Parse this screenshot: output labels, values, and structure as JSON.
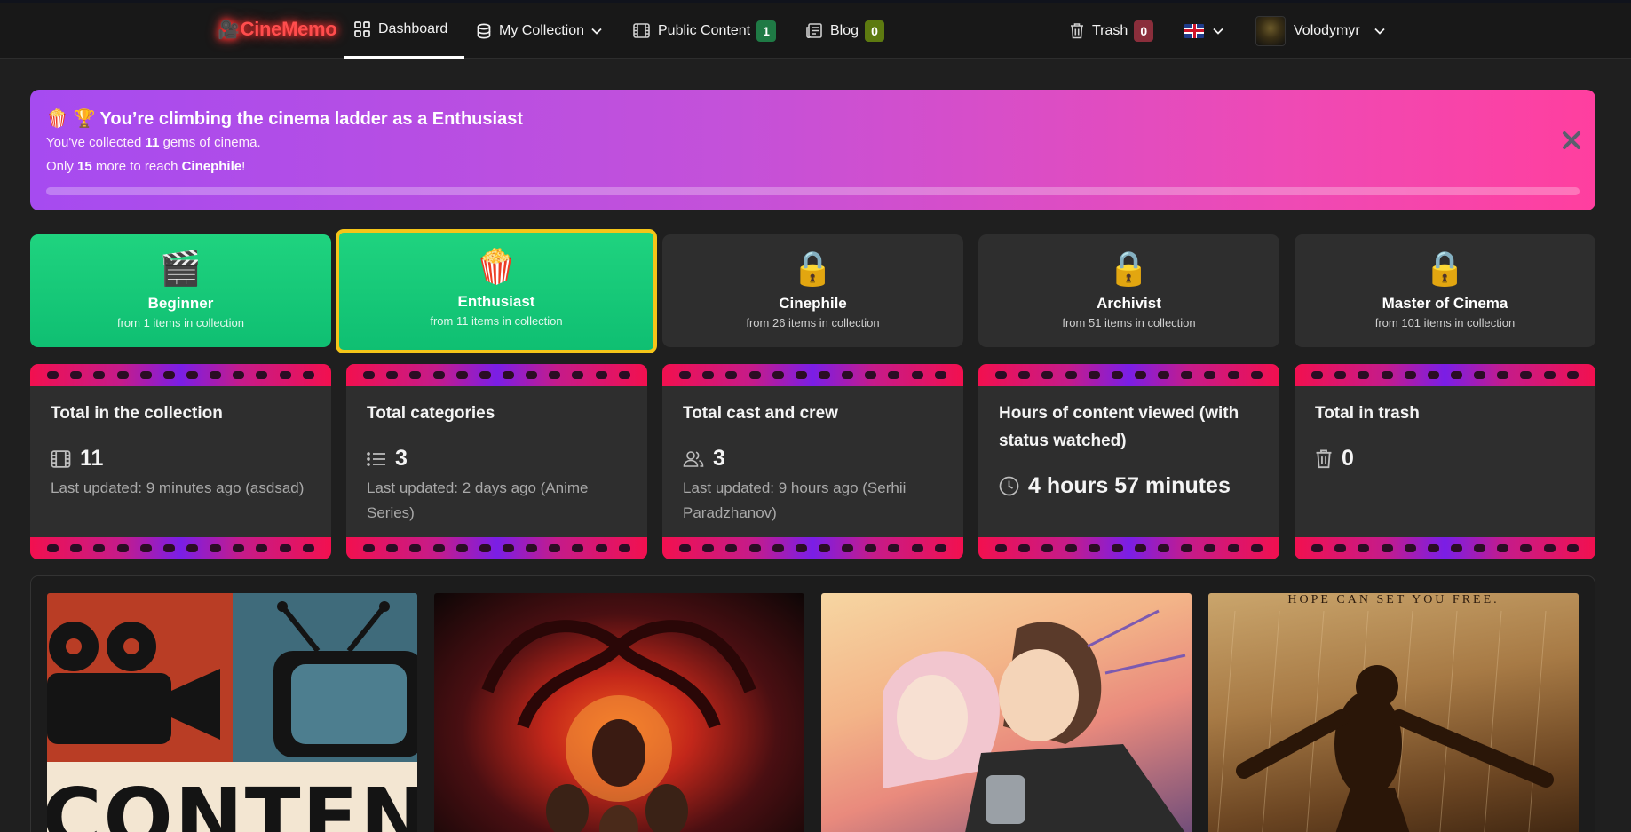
{
  "nav": {
    "brand": "CineMemo",
    "dashboard": "Dashboard",
    "collection": "My Collection",
    "public_content": "Public Content",
    "public_count": "1",
    "blog": "Blog",
    "blog_count": "0",
    "trash": "Trash",
    "trash_count": "0",
    "user": "Volodymyr"
  },
  "banner": {
    "title": "🍿 🏆 You’re climbing the cinema ladder as a Enthusiast",
    "line1_pre": "You've collected ",
    "line1_num": "11",
    "line1_post": " gems of cinema.",
    "line2_pre": "Only ",
    "line2_num": "15",
    "line2_mid": " more to reach ",
    "line2_level": "Cinephile",
    "line2_post": "!",
    "progress": 0
  },
  "levels": [
    {
      "emoji": "🎬",
      "name": "Beginner",
      "req": "from 1 items in collection"
    },
    {
      "emoji": "🍿",
      "name": "Enthusiast",
      "req": "from 11 items in collection"
    },
    {
      "emoji": "🔒",
      "name": "Cinephile",
      "req": "from 26 items in collection"
    },
    {
      "emoji": "🔒",
      "name": "Archivist",
      "req": "from 51 items in collection"
    },
    {
      "emoji": "🔒",
      "name": "Master of Cinema",
      "req": "from 101 items in collection"
    }
  ],
  "stats": [
    {
      "title": "Total in the collection",
      "value": "11",
      "sub": "Last updated: 9 minutes ago (asdsad)",
      "icon": "film-icon"
    },
    {
      "title": "Total categories",
      "value": "3",
      "sub": "Last updated: 2 days ago (Anime Series)",
      "icon": "list-icon"
    },
    {
      "title": "Total cast and crew",
      "value": "3",
      "sub": "Last updated: 9 hours ago (Serhii Paradzhanov)",
      "icon": "users-icon"
    },
    {
      "title": "Hours of content viewed (with status watched)",
      "value": "4 hours 57 minutes",
      "sub": "",
      "icon": "clock-icon"
    },
    {
      "title": "Total in trash",
      "value": "0",
      "sub": "",
      "icon": "trash-icon"
    }
  ],
  "posters": {
    "p1_text": "CONTENT",
    "p4_text": "HOPE CAN SET YOU FREE."
  },
  "colors": {
    "accent_green": "#1fd37f",
    "banner_start": "#a64bf0",
    "banner_end": "#ff3f9f",
    "current_level_border": "#f5c518"
  }
}
